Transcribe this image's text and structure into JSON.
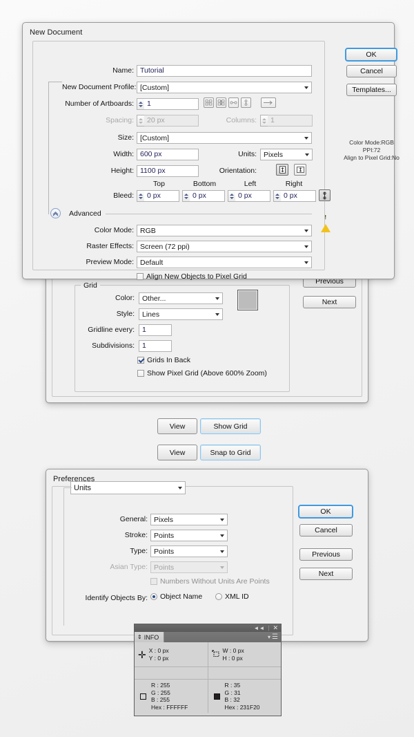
{
  "new_document": {
    "title": "New Document",
    "name_label": "Name:",
    "name_value": "Tutorial",
    "profile_label": "New Document Profile:",
    "profile_value": "[Custom]",
    "artboards_label": "Number of Artboards:",
    "artboards_value": "1",
    "spacing_label": "Spacing:",
    "spacing_value": "20 px",
    "columns_label": "Columns:",
    "columns_value": "1",
    "size_label": "Size:",
    "size_value": "[Custom]",
    "width_label": "Width:",
    "width_value": "600 px",
    "units_label": "Units:",
    "units_value": "Pixels",
    "height_label": "Height:",
    "height_value": "1100 px",
    "orientation_label": "Orientation:",
    "bleed_label": "Bleed:",
    "bleed_top_header": "Top",
    "bleed_bottom_header": "Bottom",
    "bleed_left_header": "Left",
    "bleed_right_header": "Right",
    "bleed_top": "0 px",
    "bleed_bottom": "0 px",
    "bleed_left": "0 px",
    "bleed_right": "0 px",
    "advanced_label": "Advanced",
    "color_mode_label": "Color Mode:",
    "color_mode_value": "RGB",
    "raster_label": "Raster Effects:",
    "raster_value": "Screen (72 ppi)",
    "preview_label": "Preview Mode:",
    "preview_value": "Default",
    "align_grid_label": "Align New Objects to Pixel Grid",
    "align_grid_checked": false,
    "buttons": {
      "ok": "OK",
      "cancel": "Cancel",
      "templates": "Templates..."
    },
    "summary": [
      "Color Mode:RGB",
      "PPI:72",
      "Align to Pixel Grid:No"
    ]
  },
  "grid_dialog": {
    "group_caption": "Grid",
    "color_label": "Color:",
    "color_value": "Other...",
    "style_label": "Style:",
    "style_value": "Lines",
    "gridline_label": "Gridline every:",
    "gridline_value": "1",
    "subdivisions_label": "Subdivisions:",
    "subdivisions_value": "1",
    "grids_in_back_label": "Grids In Back",
    "grids_in_back_checked": true,
    "pixel_grid_label": "Show Pixel Grid (Above 600% Zoom)",
    "pixel_grid_checked": false,
    "swatch_color": "#bcbcbc",
    "buttons": {
      "previous": "Previous",
      "next": "Next"
    }
  },
  "menu_hints": [
    {
      "menu": "View",
      "item": "Show Grid"
    },
    {
      "menu": "View",
      "item": "Snap to Grid"
    }
  ],
  "preferences": {
    "title": "Preferences",
    "section_value": "Units",
    "general_label": "General:",
    "general_value": "Pixels",
    "stroke_label": "Stroke:",
    "stroke_value": "Points",
    "type_label": "Type:",
    "type_value": "Points",
    "asian_type_label": "Asian Type:",
    "asian_type_value": "Points",
    "numbers_label": "Numbers Without Units Are Points",
    "numbers_checked": false,
    "identify_label": "Identify Objects By:",
    "identify_object_name": "Object Name",
    "identify_xml_id": "XML ID",
    "identify_selected": "Object Name",
    "buttons": {
      "ok": "OK",
      "cancel": "Cancel",
      "previous": "Previous",
      "next": "Next"
    }
  },
  "info_panel": {
    "tab_label": "INFO",
    "x_label": "X",
    "x_value": ": 0 px",
    "y_label": "Y",
    "y_value": ": 0 px",
    "w_label": "W",
    "w_value": ": 0 px",
    "h_label": "H",
    "h_value": ": 0 px",
    "fill": {
      "r": "R : 255",
      "g": "G : 255",
      "b": "B : 255",
      "hex": "Hex : FFFFFF",
      "hex_color": "#FFFFFF"
    },
    "stroke": {
      "r": "R : 35",
      "g": "G : 31",
      "b": "B : 32",
      "hex": "Hex : 231F20",
      "hex_color": "#231F20"
    }
  }
}
